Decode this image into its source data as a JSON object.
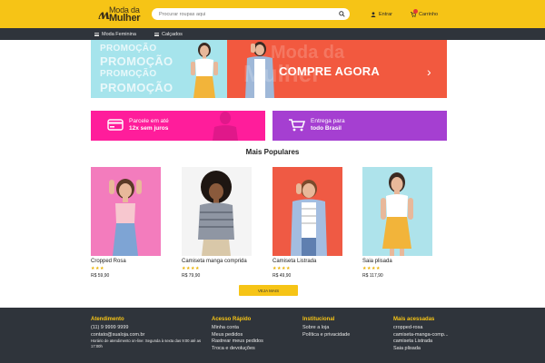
{
  "header": {
    "logo_line1": "Moda",
    "logo_line1b": "da",
    "logo_line2": "Mulher",
    "search_placeholder": "Procurar roupas aqui",
    "login_label": "Entrar",
    "cart_label": "Carrinho"
  },
  "nav": {
    "items": [
      {
        "label": "Moda Feminina",
        "icon": "menu-bars-icon"
      },
      {
        "label": "Calçados",
        "icon": "menu-bars-icon"
      }
    ]
  },
  "hero": {
    "promo_words": [
      "PROMOÇÃO",
      "PROMOÇÃO",
      "PROMOÇÃO",
      "PROMOÇÃO"
    ],
    "cta": "COMPRE AGORA",
    "watermark_line1": "Moda da",
    "watermark_line2": "Mulher",
    "next_arrow": "›",
    "colors": {
      "left": "#a6e4ec",
      "right": "#f2593f"
    }
  },
  "strips": [
    {
      "line1": "Parcele em até",
      "line2": "12x sem juros",
      "icon": "credit-card-icon",
      "color": "#ff1d9b"
    },
    {
      "line1": "Entrega para",
      "line2": "todo Brasil",
      "icon": "shopping-cart-icon",
      "color": "#a53fd1"
    }
  ],
  "section_title": "Mais Populares",
  "products": [
    {
      "name": "Cropped Rosa",
      "stars": "★★★",
      "price": "R$ 59,90",
      "bg": "#f37cbd"
    },
    {
      "name": "Camiseta manga comprida",
      "stars": "★★★★",
      "price": "R$ 79,90",
      "bg": "#f4f4f4"
    },
    {
      "name": "Camiseta Listrada",
      "stars": "★★★★",
      "price": "R$ 49,90",
      "bg": "#ef5a44"
    },
    {
      "name": "Saia plisada",
      "stars": "★★★★",
      "price": "R$ 117,90",
      "bg": "#aee3eb"
    }
  ],
  "more_button": "VEJA MAIS",
  "footer": {
    "cols": [
      {
        "title": "Atendimento",
        "lines": [
          "(11) 9 9999 9999",
          "contato@sualoja.com.br"
        ],
        "small": [
          "Horário de atendimento on-line: Segunda à sexta das 9:00 até as",
          "17:00h"
        ]
      },
      {
        "title": "Acesso Rápido",
        "lines": [
          "Minha conta",
          "Meus pedidos",
          "Rastrear meus pedidos",
          "Troca e devoluções"
        ],
        "small": []
      },
      {
        "title": "Institucional",
        "lines": [
          "Sobre a loja",
          "Política e privacidade"
        ],
        "small": []
      },
      {
        "title": "Mais acessadas",
        "lines": [
          "cropped-rosa",
          "camiseta-manga-comp...",
          "camiseta Listrada",
          "Saia plisada"
        ],
        "small": []
      }
    ]
  }
}
